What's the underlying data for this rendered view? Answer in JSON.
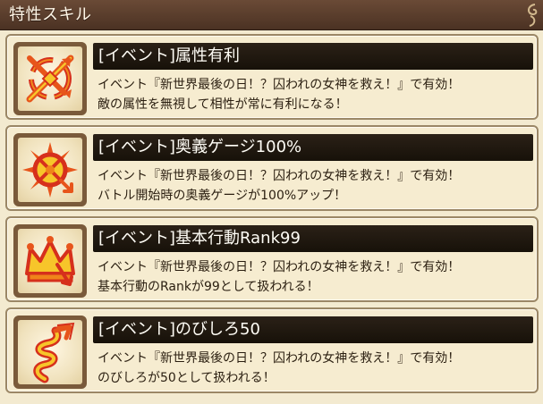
{
  "header": {
    "title": "特性スキル",
    "deco_icon": "scroll-ornament-icon"
  },
  "skills": [
    {
      "icon": "broken-compass-icon",
      "title": "[イベント]属性有利",
      "desc_line1": "イベント『新世界最後の日！？囚われの女神を救え！』で有効！",
      "desc_line2": "敵の属性を無視して相性が常に有利になる！"
    },
    {
      "icon": "spiked-sun-arrow-icon",
      "title": "[イベント]奥義ゲージ100%",
      "desc_line1": "イベント『新世界最後の日！？囚われの女神を救え！』で有効！",
      "desc_line2": "バトル開始時の奥義ゲージが100%アップ！"
    },
    {
      "icon": "crown-arrow-icon",
      "title": "[イベント]基本行動Rank99",
      "desc_line1": "イベント『新世界最後の日！？囚われの女神を救え！』で有効！",
      "desc_line2": "基本行動のRankが99として扱われる！"
    },
    {
      "icon": "spiral-arrow-icon",
      "title": "[イベント]のびしろ50",
      "desc_line1": "イベント『新世界最後の日！？囚われの女神を救え！』で有効！",
      "desc_line2": "のびしろが50として扱われる！"
    }
  ],
  "colors": {
    "header_bg": "#5a3d2b",
    "panel_bg": "#f6ecd0",
    "panel_border": "#9b8766",
    "title_bar_bg": "#1f1810",
    "icon_red": "#d6301c",
    "icon_orange": "#f0841a",
    "icon_yellow": "#f7c52a"
  }
}
